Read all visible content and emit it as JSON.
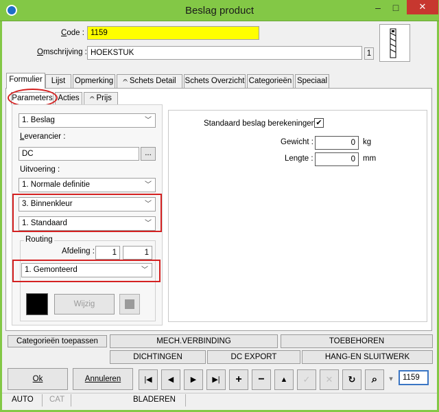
{
  "window": {
    "title": "Beslag product",
    "minimize": "–",
    "maximize": "□",
    "close": "✕"
  },
  "header": {
    "code_label": "Code :",
    "code_value": "1159",
    "omschrijving_label": "Omschrijving :",
    "omschrijving_value": "HOEKSTUK",
    "omschrijving_count": "1"
  },
  "tabs": [
    {
      "label": "Formulier"
    },
    {
      "label": "Lijst"
    },
    {
      "label": "Opmerking"
    },
    {
      "label": "Schets Detail"
    },
    {
      "label": "Schets Overzicht"
    },
    {
      "label": "Categorieën"
    },
    {
      "label": "Speciaal"
    }
  ],
  "subtabs": [
    {
      "label": "Parameters"
    },
    {
      "label": "Acties"
    },
    {
      "label": "Prijs"
    }
  ],
  "left": {
    "beslag_select": "1.  Beslag",
    "leverancier_label": "Leverancier :",
    "leverancier_value": "DC",
    "browse_label": "...",
    "uitvoering_label": "Uitvoering :",
    "uitvoering_select": "1.  Normale definitie",
    "kleur_select": "3.  Binnenkleur",
    "standaard_select": "1.  Standaard",
    "routing_label": "Routing",
    "afdeling_label": "Afdeling :",
    "afdeling_value1": "1",
    "afdeling_value2": "1",
    "gemonteerd_select": "1.  Gemonteerd",
    "wijzig_label": "Wijzig"
  },
  "right": {
    "standaard_label": "Standaard beslag berekeningen :",
    "standaard_checked": "✔",
    "gewicht_label": "Gewicht :",
    "gewicht_value": "0",
    "gewicht_unit": "kg",
    "lengte_label": "Lengte :",
    "lengte_value": "0",
    "lengte_unit": "mm"
  },
  "actions": {
    "categorieen_toepassen": "Categorieën toepassen",
    "mech_verbinding": "MECH.VERBINDING",
    "toebehoren": "TOEBEHOREN",
    "dichtingen": "DICHTINGEN",
    "dc_export": "DC EXPORT",
    "hang_sluitwerk": "HANG-EN SLUITWERK"
  },
  "nav": {
    "ok": "Ok",
    "annuleren": "Annuleren",
    "first": "|◀",
    "prev": "◀",
    "next": "▶",
    "last": "▶|",
    "add": "+",
    "remove": "−",
    "up": "▲",
    "confirm": "✓",
    "cancel": "✕",
    "refresh": "↻",
    "search": "⌕",
    "search_dropdown": "▾",
    "search_value": "1159"
  },
  "status": {
    "auto": "AUTO",
    "cat": "CAT",
    "mode": "BLADEREN"
  },
  "colors": {
    "titlebar": "#83c846",
    "code_highlight": "#ffff00",
    "annotation_red": "#d42020"
  }
}
